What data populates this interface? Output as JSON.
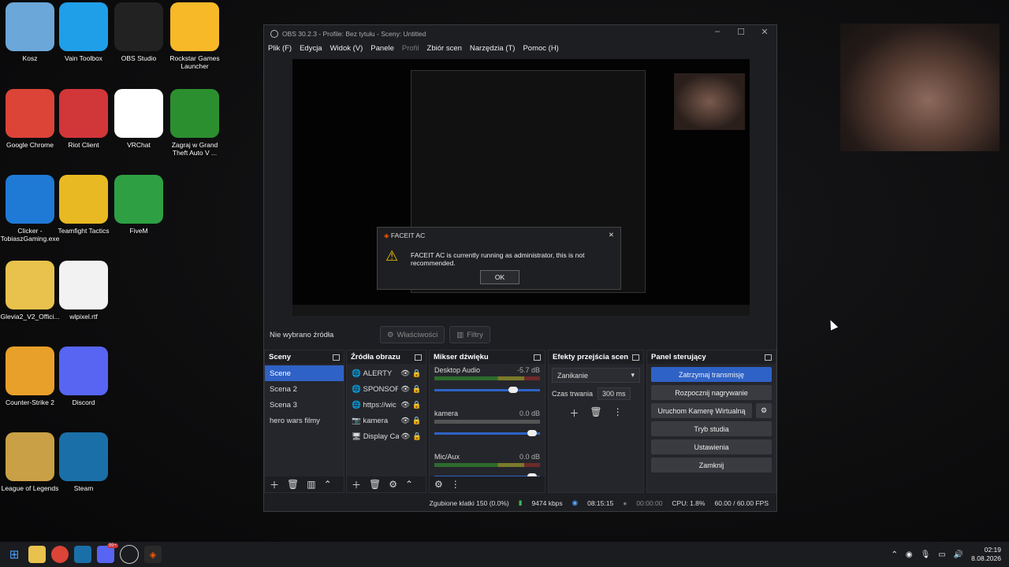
{
  "desktop": {
    "icons": [
      {
        "label": "Kosz",
        "color": "#6ba7d8"
      },
      {
        "label": "Vain Toolbox",
        "color": "#1f9fe8"
      },
      {
        "label": "OBS Studio",
        "color": "#222222"
      },
      {
        "label": "Rockstar Games Launcher",
        "color": "#f7b928"
      },
      {
        "label": "Google Chrome",
        "color": "#db4437"
      },
      {
        "label": "Riot Client",
        "color": "#d13639"
      },
      {
        "label": "VRChat",
        "color": "#ffffff"
      },
      {
        "label": "Zagraj w Grand Theft Auto V ...",
        "color": "#2c8f2f"
      },
      {
        "label": "Clicker - TobiaszGaming.exe",
        "color": "#1f7ad6"
      },
      {
        "label": "Teamfight Tactics",
        "color": "#e8b923"
      },
      {
        "label": "FiveM",
        "color": "#2ea043"
      },
      {
        "label": "Glevia2_V2_Offici...",
        "color": "#e8c24c"
      },
      {
        "label": "wlpixel.rtf",
        "color": "#f2f2f2"
      },
      {
        "label": "Counter-Strike 2",
        "color": "#e8a02a"
      },
      {
        "label": "Discord",
        "color": "#5865f2"
      },
      {
        "label": "League of Legends",
        "color": "#c9a046"
      },
      {
        "label": "Steam",
        "color": "#1b6fa8"
      }
    ]
  },
  "obs": {
    "title": "OBS 30.2.3 - Profile: Bez tytułu - Sceny: Untitled",
    "menu": [
      "Plik (F)",
      "Edycja",
      "Widok (V)",
      "Panele",
      "Profil",
      "Zbiór scen",
      "Narzędzia (T)",
      "Pomoc (H)"
    ],
    "no_source": "Nie wybrano źródła",
    "properties": "Właściwości",
    "filters": "Filtry",
    "dialog": {
      "title": "FACEIT AC",
      "message": "FACEIT AC is currently running as administrator, this is not recommended.",
      "ok": "OK"
    },
    "scenes": {
      "title": "Sceny",
      "items": [
        "Scene",
        "Scena 2",
        "Scena 3",
        "hero wars filmy"
      ]
    },
    "sources": {
      "title": "Źródła obrazu",
      "items": [
        "ALERTY",
        "SPONSORZ",
        "https://wic",
        "kamera",
        "Display Caj"
      ]
    },
    "mixer": {
      "title": "Mikser dźwięku",
      "channels": [
        {
          "name": "Desktop Audio",
          "level": "-5.7 dB",
          "volume": 0.7
        },
        {
          "name": "kamera",
          "level": "0.0 dB",
          "volume": 0.95
        },
        {
          "name": "Mic/Aux",
          "level": "0.0 dB",
          "volume": 0.95
        }
      ],
      "scale": "-60-55-50-45-40-35-30-25-20-15-10 -5 0"
    },
    "transitions": {
      "title": "Efekty przejścia scen",
      "selected": "Zanikanie",
      "duration_label": "Czas trwania",
      "duration": "300 ms"
    },
    "controls": {
      "title": "Panel sterujący",
      "buttons": [
        "Zatrzymaj transmisję",
        "Rozpocznij nagrywanie",
        "Uruchom Kamerę Wirtualną",
        "Tryb studia",
        "Ustawienia",
        "Zamknij"
      ]
    },
    "status": {
      "dropped": "Zgubione klatki 150 (0.0%)",
      "bitrate": "9474 kbps",
      "stream_time": "08:15:15",
      "rec_time": "00:00:00",
      "cpu": "CPU: 1.8%",
      "fps": "60.00 / 60.00 FPS"
    }
  },
  "taskbar": {
    "time": "02:19",
    "date": "8.08.2026",
    "badge": "99+"
  }
}
